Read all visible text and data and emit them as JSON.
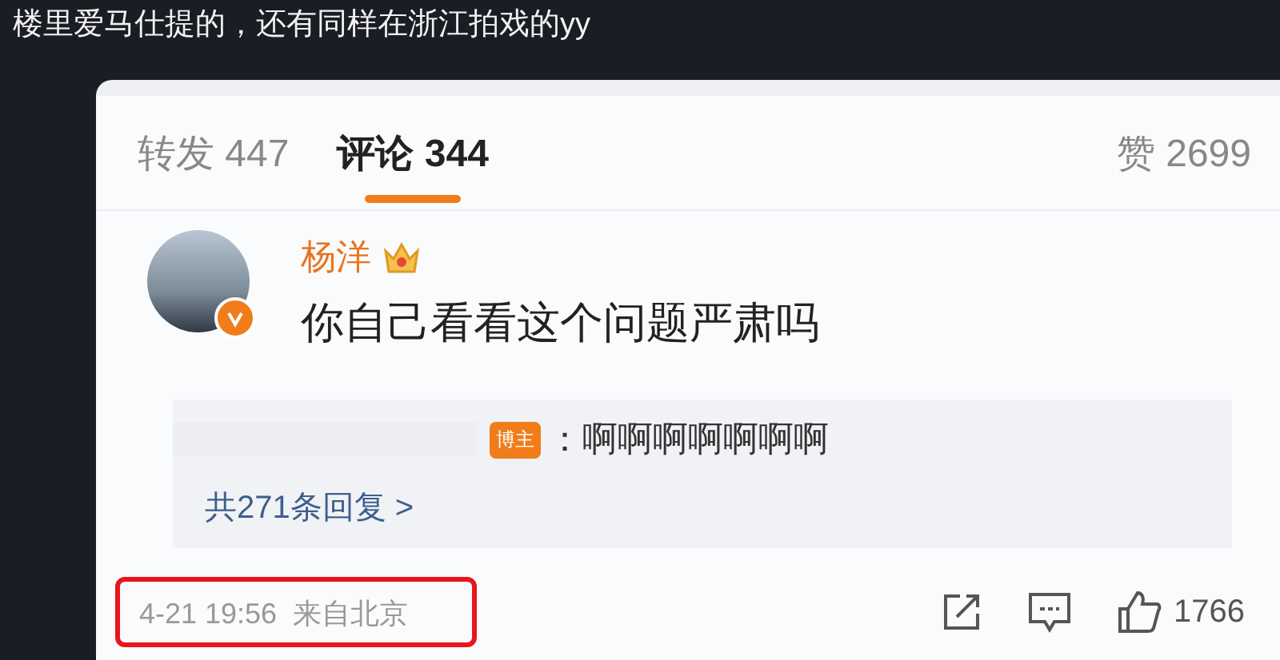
{
  "caption": "楼里爱马仕提的，还有同样在浙江拍戏的yy",
  "tabs": [
    {
      "label": "转发",
      "count": "447",
      "selected": false
    },
    {
      "label": "评论",
      "count": "344",
      "selected": true
    }
  ],
  "likes_tab": {
    "label": "赞",
    "count": "2699"
  },
  "comment": {
    "author": "杨洋",
    "verified": true,
    "text": "你自己看看这个问题严肃吗",
    "reply": {
      "badge": "博主",
      "text": "：啊啊啊啊啊啊啊"
    },
    "reply_count": "共271条回复 >",
    "meta": "4-21 19:56  来自北京",
    "highlighted": true,
    "likes": "1766"
  }
}
